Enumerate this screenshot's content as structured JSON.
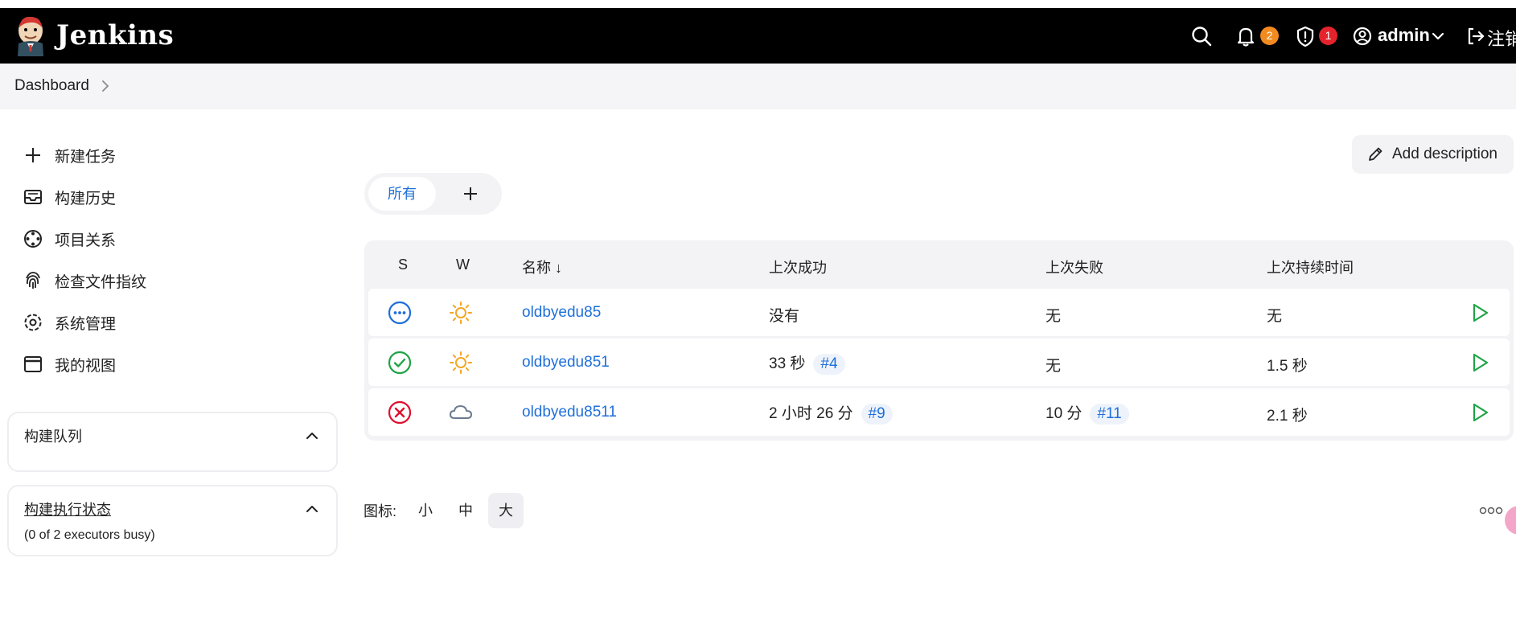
{
  "header": {
    "brand": "Jenkins",
    "notifications_count": "2",
    "security_count": "1",
    "user": "admin",
    "logout": "注销",
    "colors": {
      "bg": "#000000",
      "notif_badge": "#f28b1f",
      "security_badge": "#e5232d"
    }
  },
  "breadcrumb": {
    "item": "Dashboard"
  },
  "sidebar": {
    "items": [
      {
        "label": "新建任务",
        "icon": "plus-icon"
      },
      {
        "label": "构建历史",
        "icon": "inbox-icon"
      },
      {
        "label": "项目关系",
        "icon": "relation-icon"
      },
      {
        "label": "检查文件指纹",
        "icon": "fingerprint-icon"
      },
      {
        "label": "系统管理",
        "icon": "gear-icon"
      },
      {
        "label": "我的视图",
        "icon": "window-icon"
      }
    ],
    "build_queue": {
      "title": "构建队列"
    },
    "executors": {
      "title": "构建执行状态",
      "status": "(0 of 2 executors busy)"
    }
  },
  "main": {
    "add_description": "Add description",
    "tabs": {
      "active": "所有"
    },
    "table": {
      "headers": {
        "s": "S",
        "w": "W",
        "name": "名称 ↓",
        "last_success": "上次成功",
        "last_failure": "上次失败",
        "last_duration": "上次持续时间"
      },
      "rows": [
        {
          "status": "in-progress",
          "weather": "sunny",
          "name": "oldbyedu85",
          "last_success": "没有",
          "last_success_build": "",
          "last_failure": "无",
          "last_failure_build": "",
          "duration": "无"
        },
        {
          "status": "success",
          "weather": "sunny",
          "name": "oldbyedu851",
          "last_success": "33 秒",
          "last_success_build": "#4",
          "last_failure": "无",
          "last_failure_build": "",
          "duration": "1.5 秒"
        },
        {
          "status": "failed",
          "weather": "cloudy",
          "name": "oldbyedu8511",
          "last_success": "2 小时 26 分",
          "last_success_build": "#9",
          "last_failure": "10 分",
          "last_failure_build": "#11",
          "duration": "2.1 秒"
        }
      ]
    },
    "icon_size": {
      "label": "图标:",
      "options": [
        "小",
        "中",
        "大"
      ],
      "selected": "大"
    },
    "colors": {
      "link": "#1e6fd9",
      "success": "#1ea446",
      "failure": "#e0102f",
      "sunny": "#f5a623",
      "cloud": "#6b7a8f",
      "run": "#1ea446"
    }
  }
}
